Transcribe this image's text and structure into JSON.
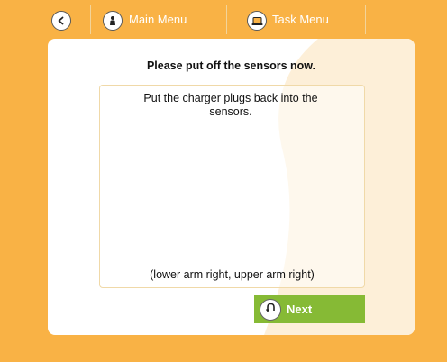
{
  "header": {
    "back_icon": "back-arrow-icon",
    "main_menu_label": "Main Menu",
    "main_menu_icon": "person-icon",
    "task_menu_label": "Task Menu",
    "task_menu_icon": "laptop-icon"
  },
  "panel": {
    "instruction": "Please put off the sensors now.",
    "detail": "Put the charger plugs back into the sensors.",
    "note": "(lower arm right, upper arm right)",
    "next_label": "Next",
    "next_icon": "rotate-arrow-icon"
  },
  "colors": {
    "background": "#f9b245",
    "panel": "#ffffff",
    "next_button": "#86ba35"
  }
}
